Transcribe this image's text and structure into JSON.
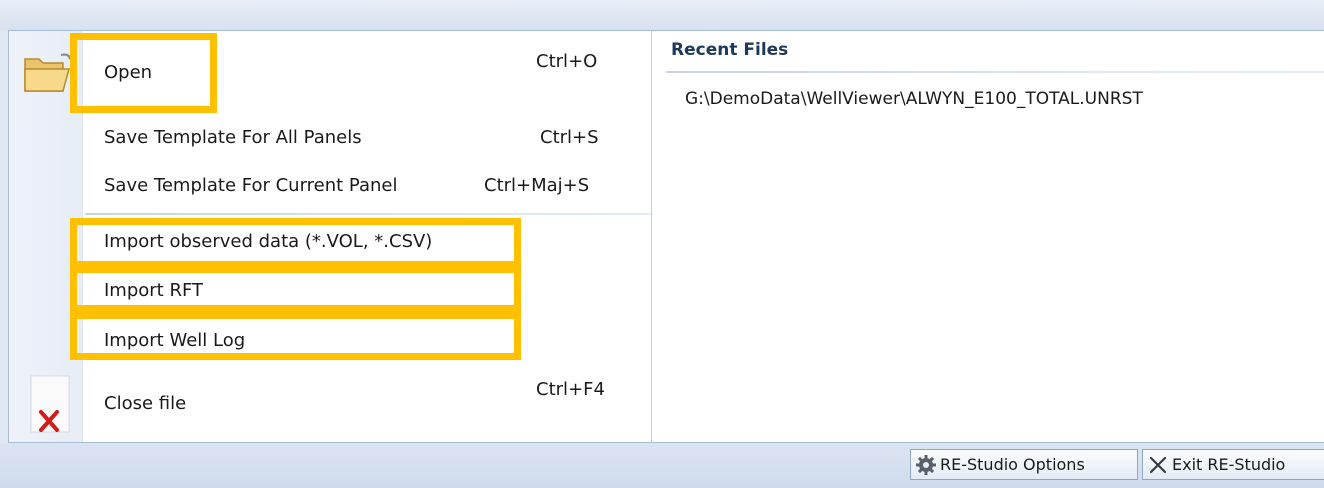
{
  "menu": {
    "items": [
      {
        "label": "Open",
        "shortcut": "Ctrl+O",
        "icon": "open-folder-icon"
      },
      {
        "label": "Save Template For All Panels",
        "shortcut": "Ctrl+S"
      },
      {
        "label": "Save Template For Current Panel",
        "shortcut": "Ctrl+Maj+S"
      },
      {
        "label": "Import observed data (*.VOL, *.CSV)"
      },
      {
        "label": "Import RFT"
      },
      {
        "label": "Import Well Log"
      },
      {
        "label": "Close file",
        "shortcut": "Ctrl+F4",
        "icon": "close-file-icon"
      }
    ]
  },
  "recent": {
    "title": "Recent Files",
    "files": [
      "G:\\DemoData\\WellViewer\\ALWYN_E100_TOTAL.UNRST"
    ]
  },
  "footer": {
    "options_label": "RE-Studio Options",
    "exit_label": "Exit RE-Studio"
  },
  "colors": {
    "highlight": "#ffc000",
    "title_text": "#1e395b",
    "close_x": "#d01c1c"
  }
}
